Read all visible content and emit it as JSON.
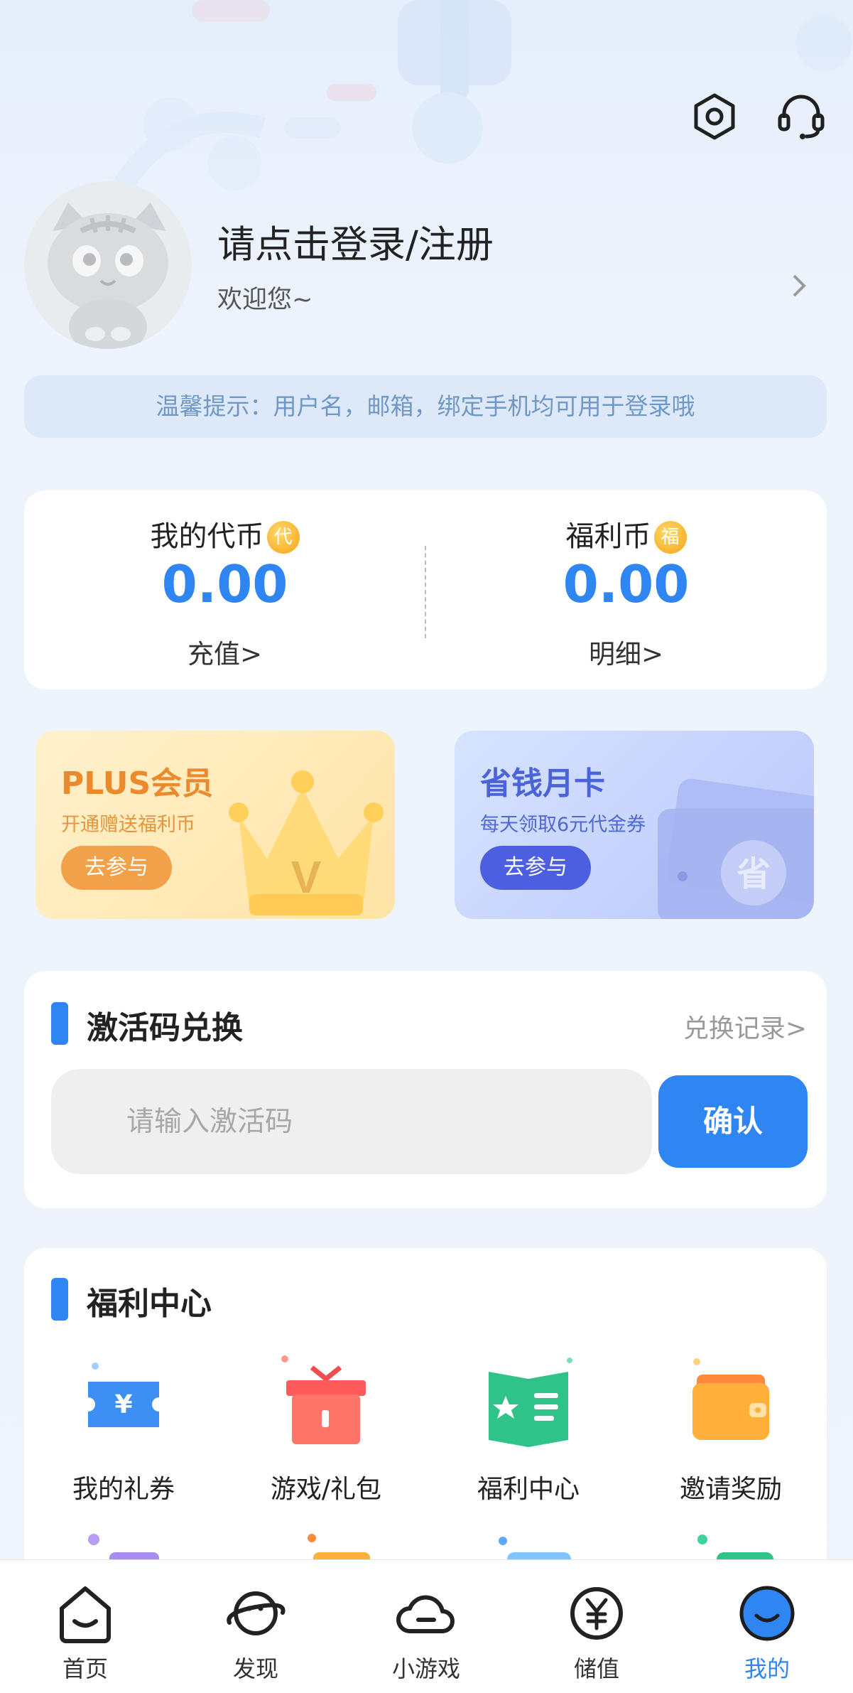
{
  "header": {
    "settings_icon": "settings-hexagon-icon",
    "service_icon": "customer-service-headset-icon"
  },
  "profile": {
    "login_text": "请点击登录/注册",
    "welcome_text": "欢迎您~",
    "avatar_icon": "cat-avatar-icon"
  },
  "tip": {
    "text": "温馨提示：用户名，邮箱，绑定手机均可用于登录哦"
  },
  "balance": {
    "tokens": {
      "label": "我的代币",
      "badge": "代",
      "value": "0.00",
      "link": "充值>"
    },
    "welfare": {
      "label": "福利币",
      "badge": "福",
      "value": "0.00",
      "link": "明细>"
    }
  },
  "promos": {
    "plus": {
      "title": "PLUS会员",
      "subtitle": "开通赠送福利币",
      "button": "去参与",
      "badge": "V"
    },
    "month": {
      "title": "省钱月卡",
      "subtitle": "每天领取6元代金券",
      "button": "去参与",
      "badge": "省"
    }
  },
  "activation": {
    "title": "激活码兑换",
    "record_link": "兑换记录>",
    "placeholder": "请输入激活码",
    "confirm": "确认"
  },
  "welfare_center": {
    "title": "福利中心",
    "items": [
      {
        "label": "我的礼券",
        "icon": "coupon-icon"
      },
      {
        "label": "游戏/礼包",
        "icon": "gift-box-icon"
      },
      {
        "label": "福利中心",
        "icon": "welfare-book-icon"
      },
      {
        "label": "邀请奖励",
        "icon": "wallet-icon"
      }
    ]
  },
  "nav": {
    "items": [
      {
        "label": "首页",
        "icon": "home-icon"
      },
      {
        "label": "发现",
        "icon": "planet-icon"
      },
      {
        "label": "小游戏",
        "icon": "cloud-game-icon"
      },
      {
        "label": "储值",
        "icon": "yuan-coin-icon"
      },
      {
        "label": "我的",
        "icon": "profile-icon",
        "active": true
      }
    ]
  },
  "colors": {
    "accent": "#2f86f2",
    "plus_accent": "#ea8a2d",
    "month_accent": "#4a63d8"
  }
}
